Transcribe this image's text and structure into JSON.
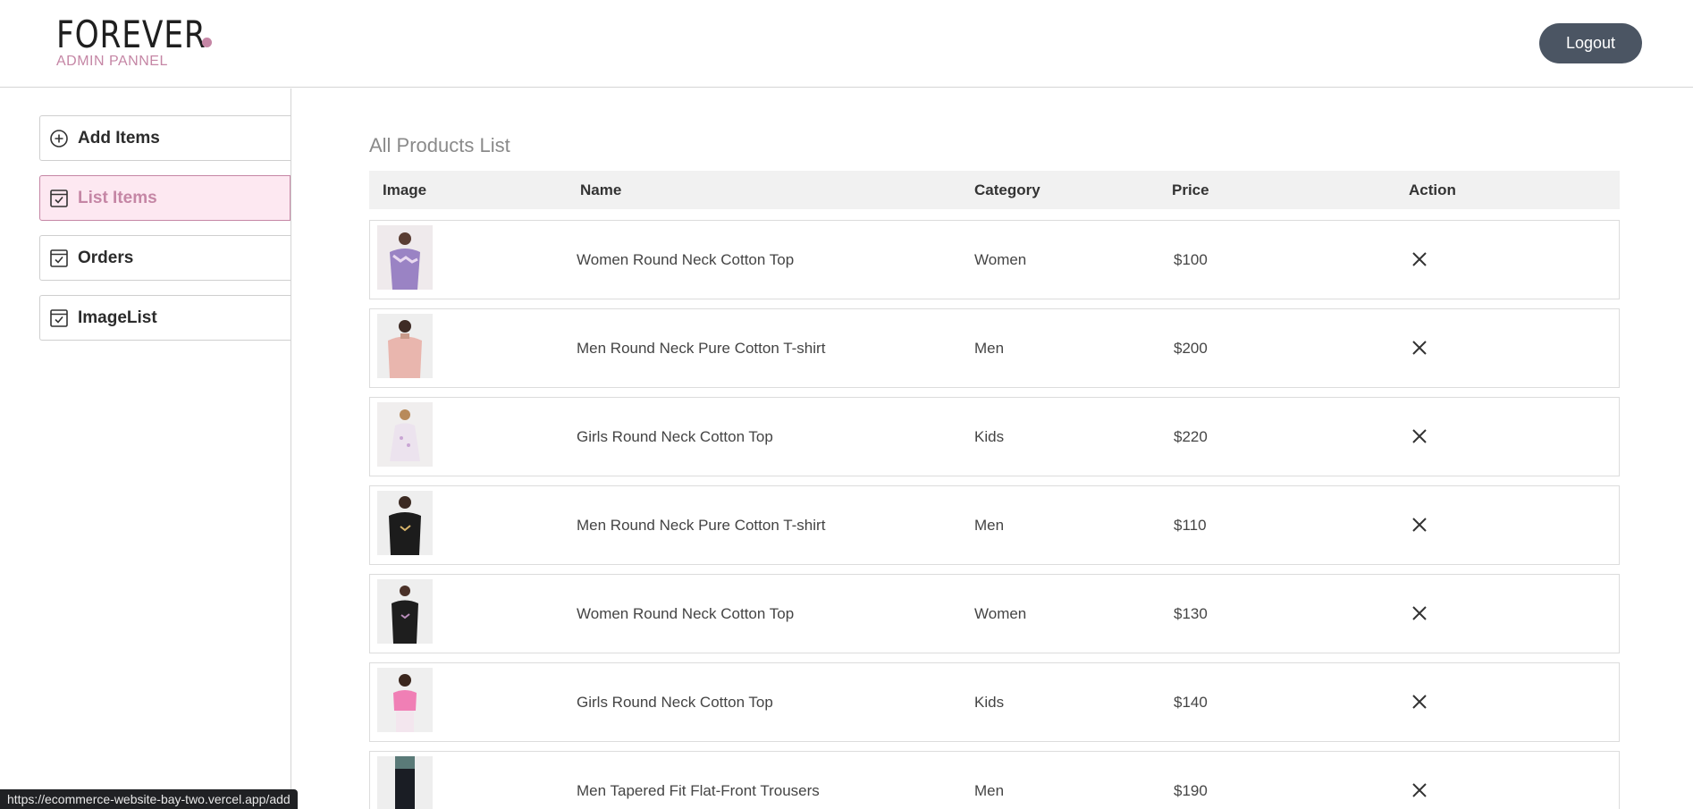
{
  "header": {
    "logo_text": "FOREVER",
    "logo_sub": "ADMIN PANNEL",
    "logout_label": "Logout"
  },
  "sidebar": {
    "items": [
      {
        "label": "Add Items",
        "icon": "add-circle-icon",
        "active": false
      },
      {
        "label": "List Items",
        "icon": "checklist-icon",
        "active": true
      },
      {
        "label": "Orders",
        "icon": "checklist-icon",
        "active": false
      },
      {
        "label": "ImageList",
        "icon": "checklist-icon",
        "active": false
      }
    ]
  },
  "main": {
    "title": "All Products List",
    "columns": [
      "Image",
      "Name",
      "Category",
      "Price",
      "Action"
    ],
    "rows": [
      {
        "name": "Women Round Neck Cotton Top",
        "category": "Women",
        "price": "$100",
        "action": "X"
      },
      {
        "name": "Men Round Neck Pure Cotton T-shirt",
        "category": "Men",
        "price": "$200",
        "action": "X"
      },
      {
        "name": "Girls Round Neck Cotton Top",
        "category": "Kids",
        "price": "$220",
        "action": "X"
      },
      {
        "name": "Men Round Neck Pure Cotton T-shirt",
        "category": "Men",
        "price": "$110",
        "action": "X"
      },
      {
        "name": "Women Round Neck Cotton Top",
        "category": "Women",
        "price": "$130",
        "action": "X"
      },
      {
        "name": "Girls Round Neck Cotton Top",
        "category": "Kids",
        "price": "$140",
        "action": "X"
      },
      {
        "name": "Men Tapered Fit Flat-Front Trousers",
        "category": "Men",
        "price": "$190",
        "action": "X"
      }
    ]
  },
  "status_url": "https://ecommerce-website-bay-two.vercel.app/add",
  "colors": {
    "accent": "#c586a5",
    "active_bg": "#fde8f1",
    "logout_bg": "#4b5563"
  }
}
